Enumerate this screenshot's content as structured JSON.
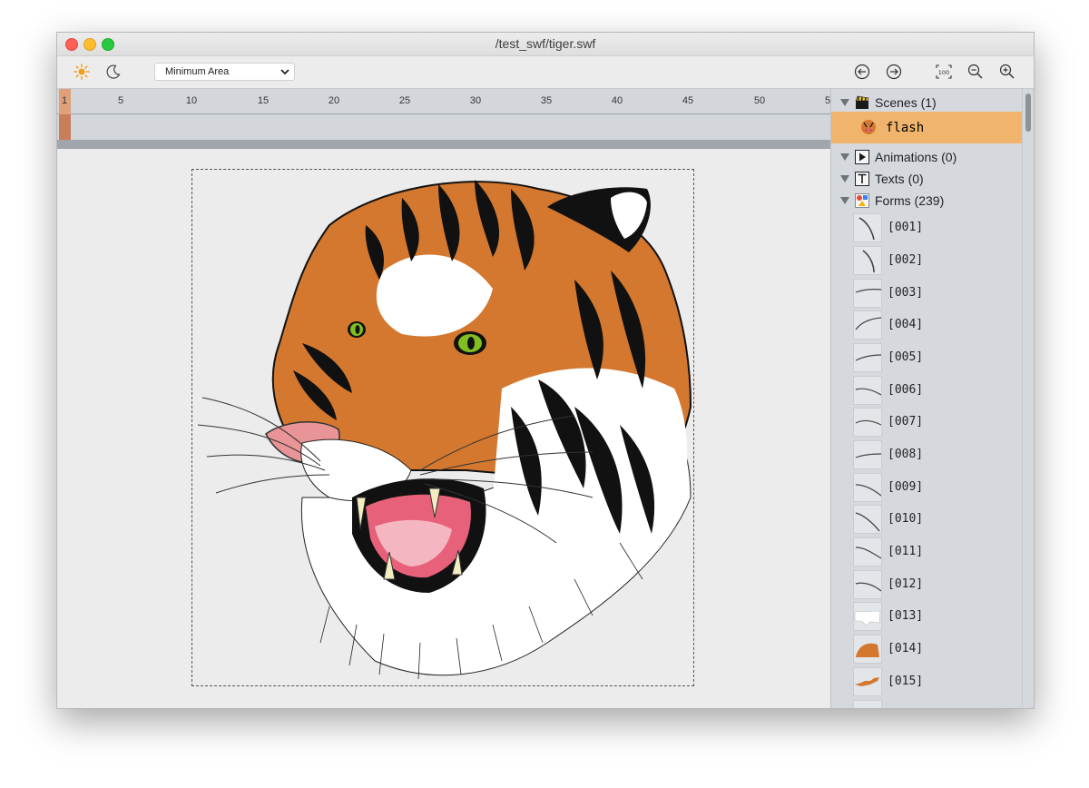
{
  "window": {
    "title": "/test_swf/tiger.swf"
  },
  "toolbar": {
    "light_theme_icon": "sun-icon",
    "dark_theme_icon": "moon-icon",
    "view_mode": {
      "value": "Minimum Area"
    },
    "nav_icons": [
      "arrow-left-circle-icon",
      "arrow-right-circle-icon",
      "fit-100-icon",
      "zoom-out-icon",
      "zoom-in-icon"
    ],
    "fit_label": "100"
  },
  "timeline": {
    "ticks": [
      "5",
      "10",
      "15",
      "20",
      "25",
      "30",
      "35",
      "40",
      "45",
      "50",
      "5"
    ],
    "current_frame": "1"
  },
  "sidebar": {
    "scenes": {
      "label": "Scenes (1)",
      "items": [
        {
          "label": "flash"
        }
      ]
    },
    "animations": {
      "label": "Animations (0)"
    },
    "texts": {
      "label": "Texts (0)"
    },
    "forms": {
      "label": "Forms (239)",
      "items": [
        "[001]",
        "[002]",
        "[003]",
        "[004]",
        "[005]",
        "[006]",
        "[007]",
        "[008]",
        "[009]",
        "[010]",
        "[011]",
        "[012]",
        "[013]",
        "[014]",
        "[015]"
      ]
    }
  },
  "colors": {
    "accent_selection": "#f1b46c",
    "frame_marker": "#e0a07a",
    "tiger_orange": "#d4782f"
  }
}
